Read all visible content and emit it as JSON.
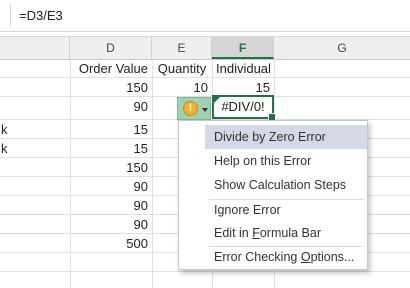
{
  "formula_bar": {
    "formula": "=D3/E3"
  },
  "columns": [
    {
      "name": "D",
      "selected": false
    },
    {
      "name": "E",
      "selected": false
    },
    {
      "name": "F",
      "selected": true
    },
    {
      "name": "G",
      "selected": false
    }
  ],
  "headers": {
    "order_value": "Order Value",
    "quantity": "Quantity",
    "individual": "Individual"
  },
  "rows": [
    {
      "d": "150",
      "e": "10",
      "f": "15",
      "left_fragment": ""
    },
    {
      "d": "90",
      "e": "",
      "f": "#DIV/0!",
      "left_fragment": ""
    },
    {
      "d": "15",
      "e": "",
      "f": "",
      "left_fragment": "k"
    },
    {
      "d": "15",
      "e": "",
      "f": "",
      "left_fragment": "k"
    },
    {
      "d": "150",
      "e": "",
      "f": "",
      "left_fragment": ""
    },
    {
      "d": "90",
      "e": "",
      "f": "",
      "left_fragment": ""
    },
    {
      "d": "90",
      "e": "",
      "f": "",
      "left_fragment": ""
    },
    {
      "d": "90",
      "e": "",
      "f": "",
      "left_fragment": ""
    },
    {
      "d": "500",
      "e": "",
      "f": "",
      "left_fragment": ""
    }
  ],
  "error_menu": {
    "items": [
      {
        "label": "Divide by Zero Error",
        "highlighted": true
      },
      {
        "label": "Help on this Error"
      },
      {
        "label": "Show Calculation Steps"
      },
      {
        "label": "Ignore Error"
      },
      {
        "label_pre": "Edit in ",
        "label_u": "F",
        "label_post": "ormula Bar"
      },
      {
        "label_pre": "Error Checking ",
        "label_u": "O",
        "label_post": "ptions..."
      }
    ]
  },
  "colors": {
    "accent": "#217346",
    "highlight": "#d5d9e6",
    "warning": "#f2b132"
  }
}
